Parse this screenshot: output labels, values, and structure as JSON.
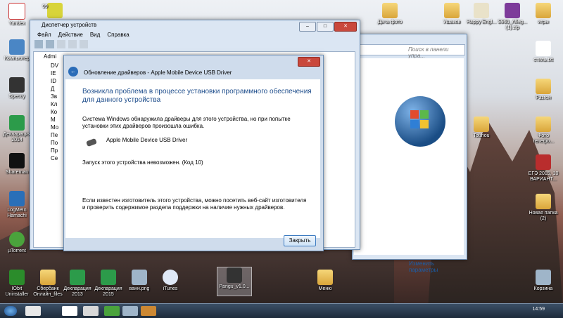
{
  "desktop_icons": [
    {
      "label": "Yandex",
      "icon": "yandex-icon"
    },
    {
      "label": "Компьютер",
      "icon": "computer-icon"
    },
    {
      "label": "Speccy",
      "icon": "speccy-icon"
    },
    {
      "label": "Декларация 2014",
      "icon": "declaration-icon"
    },
    {
      "label": "Shareman",
      "icon": "shareman-icon"
    },
    {
      "label": "LogMeIn Hamachi",
      "icon": "hamachi-icon"
    },
    {
      "label": "µTorrent",
      "icon": "utorrent-icon"
    },
    {
      "label": "IObit Uninstaller",
      "icon": "iobit-icon"
    },
    {
      "label": "Сбербанк Онлайн_files",
      "icon": "folder-icon"
    },
    {
      "label": "Декларация 2013",
      "icon": "declaration-icon"
    },
    {
      "label": "Декларация 2015",
      "icon": "declaration-icon"
    },
    {
      "label": "ванн.png",
      "icon": "image-icon"
    },
    {
      "label": "iTunes",
      "icon": "itunes-icon"
    },
    {
      "label": "Pangu_v1.0...",
      "icon": "pangu-icon"
    },
    {
      "label": "Меню",
      "icon": "folder-icon"
    },
    {
      "label": "Корзина",
      "icon": "recycle-bin-icon"
    },
    {
      "label": "Ушаков",
      "icon": "folder-icon"
    },
    {
      "label": "Happy Engl...",
      "icon": "happy-english-icon"
    },
    {
      "label": "S960_Alleg... (1).zip",
      "icon": "zip-icon"
    },
    {
      "label": "игры",
      "icon": "folder-icon"
    },
    {
      "label": "стиль.txt",
      "icon": "text-file-icon"
    },
    {
      "label": "Разгон",
      "icon": "folder-icon"
    },
    {
      "label": "Touhou",
      "icon": "folder-icon"
    },
    {
      "label": "Фото телефо...",
      "icon": "folder-icon"
    },
    {
      "label": "ЕГЭ 2015, 10 ВАРИАНТ...",
      "icon": "pdf-icon"
    },
    {
      "label": "Новая папка (2)",
      "icon": "folder-icon"
    },
    {
      "label": "Дача фото",
      "icon": "folder-icon"
    },
    {
      "label": "99",
      "icon": "badge"
    }
  ],
  "device_manager": {
    "title": "Диспетчер устройств",
    "menu": [
      "Файл",
      "Действие",
      "Вид",
      "Справка"
    ],
    "tree_root": "Admi",
    "tree_partial": [
      "DV",
      "IE",
      "ID",
      "Д",
      "Зв",
      "Кл",
      "Ко",
      "М",
      "Мо",
      "Пе",
      "По",
      "Пр",
      "Се"
    ]
  },
  "control_panel": {
    "search_placeholder": "Поиск в панели упра...",
    "link": "Изменить параметры"
  },
  "dialog": {
    "title": "Обновление драйверов - Apple Mobile Device USB Driver",
    "heading": "Возникла проблема в процессе установки программного обеспечения для данного устройства",
    "message": "Система Windows обнаружила драйверы для этого устройства, но при попытке установки этих драйверов произошла ошибка.",
    "device_name": "Apple Mobile Device USB Driver",
    "error": "Запуск этого устройства невозможен. (Код 10)",
    "vendor_hint": "Если известен изготовитель этого устройства, можно посетить веб-сайт изготовителя и проверить содержимое раздела поддержки на наличие нужных драйверов.",
    "close_button": "Закрыть"
  },
  "taskbar": {
    "clock": "14:59"
  }
}
